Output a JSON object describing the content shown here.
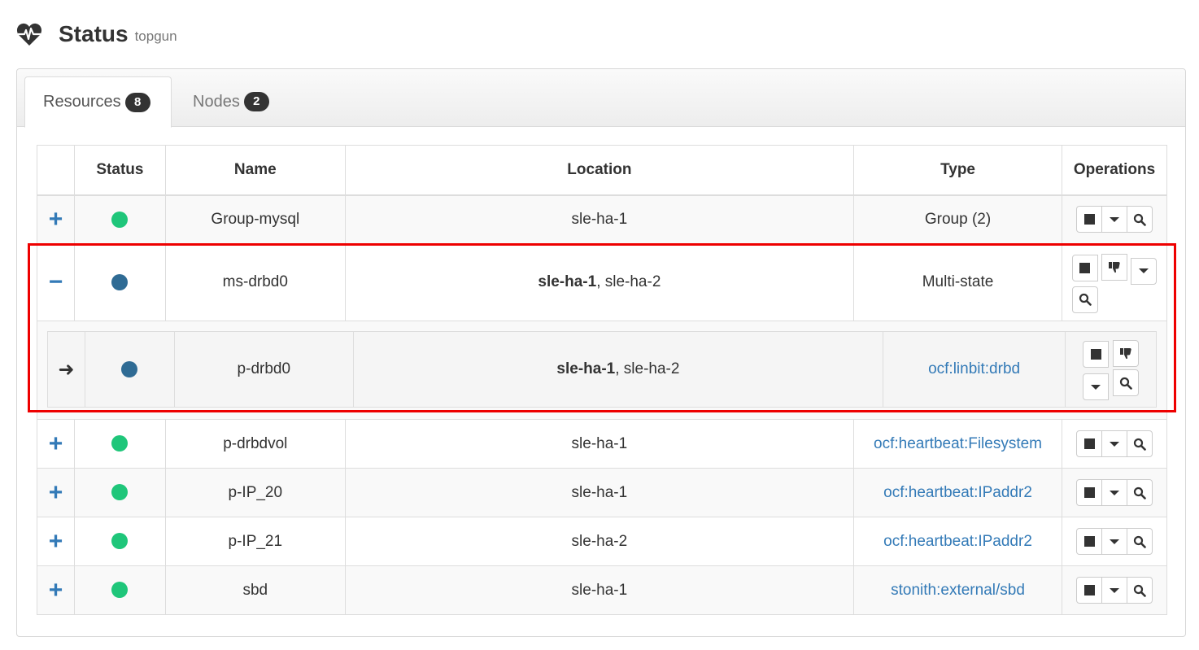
{
  "header": {
    "title": "Status",
    "subtitle": "topgun"
  },
  "tabs": [
    {
      "label": "Resources",
      "count": "8",
      "active": true
    },
    {
      "label": "Nodes",
      "count": "2",
      "active": false
    }
  ],
  "table": {
    "columns": [
      "",
      "Status",
      "Name",
      "Location",
      "Type",
      "Operations"
    ],
    "rows": [
      {
        "expander": "+",
        "status_color": "#1fc67a",
        "name": "Group-mysql",
        "location": "sle-ha-1",
        "type": "Group (2)"
      },
      {
        "expander": "−",
        "status_color": "#2f6b94",
        "name": "ms-drbd0",
        "location_primary": "sle-ha-1",
        "location_rest": ", sle-ha-2",
        "type": "Multi-state",
        "child": {
          "expander": "➜",
          "status_color": "#2f6b94",
          "name": "p-drbd0",
          "location_primary": "sle-ha-1",
          "location_rest": ", sle-ha-2",
          "type": "ocf:linbit:drbd"
        }
      },
      {
        "expander": "+",
        "status_color": "#1fc67a",
        "name": "p-drbdvol",
        "location": "sle-ha-1",
        "type": "ocf:heartbeat:Filesystem"
      },
      {
        "expander": "+",
        "status_color": "#1fc67a",
        "name": "p-IP_20",
        "location": "sle-ha-1",
        "type": "ocf:heartbeat:IPaddr2"
      },
      {
        "expander": "+",
        "status_color": "#1fc67a",
        "name": "p-IP_21",
        "location": "sle-ha-2",
        "type": "ocf:heartbeat:IPaddr2"
      },
      {
        "expander": "+",
        "status_color": "#1fc67a",
        "name": "sbd",
        "location": "sle-ha-1",
        "type": "stonith:external/sbd"
      }
    ]
  },
  "icons": {
    "header": "heartbeat-icon",
    "stop": "stop-icon",
    "demote": "thumbs-down-icon",
    "menu": "caret-down-icon",
    "details": "search-icon",
    "child": "arrow-right-icon"
  },
  "colors": {
    "link": "#337ab7",
    "running": "#1fc67a",
    "master": "#2f6b94",
    "highlight": "#ee0000"
  }
}
